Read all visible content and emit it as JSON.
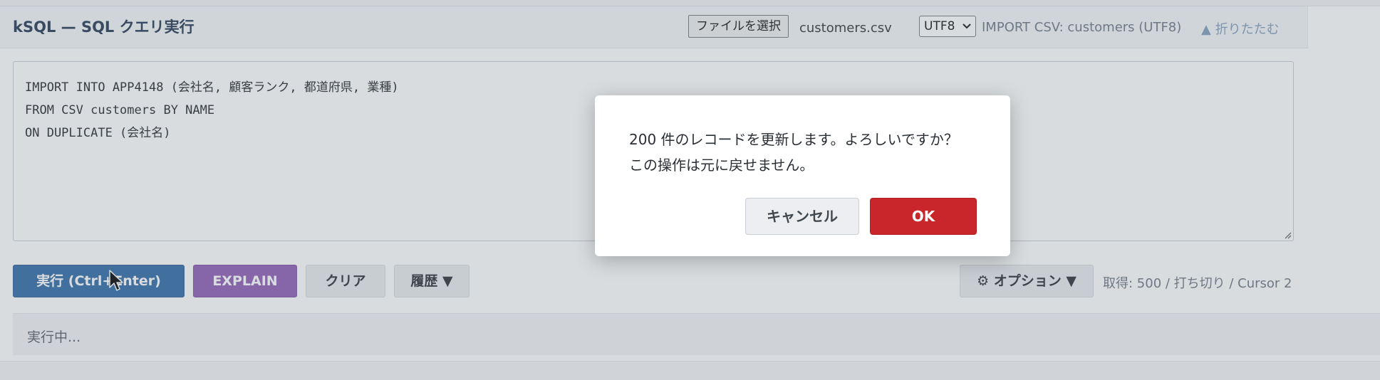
{
  "header": {
    "title": "kSQL — SQL クエリ実行",
    "file_button": "ファイルを選択",
    "file_name": "customers.csv",
    "encoding": "UTF8",
    "import_label": "IMPORT CSV: customers (UTF8)",
    "collapse_link": "▲ 折りたたむ"
  },
  "editor": {
    "line1": "IMPORT INTO APP4148 (会社名, 顧客ランク, 都道府県, 業種)",
    "line2": "FROM CSV customers BY NAME",
    "line3": "ON DUPLICATE (会社名)"
  },
  "toolbar": {
    "run_label": "実行 (Ctrl+Enter)",
    "explain_label": "EXPLAIN",
    "clear_label": "クリア",
    "history_label": "履歴 ▼",
    "options_label": "⚙ オプション ▼",
    "fetch_info": "取得: 500 / 打ち切り / Cursor 2"
  },
  "status": {
    "text": "実行中..."
  },
  "dialog": {
    "message_line1": "200 件のレコードを更新します。よろしいですか？",
    "message_line2": "この操作は元に戻せません。",
    "cancel_label": "キャンセル",
    "ok_label": "OK"
  },
  "colors": {
    "run_button": "#2f6aa6",
    "explain_button": "#8e5bb5",
    "ok_button": "#c9262c",
    "title": "#22364f"
  }
}
